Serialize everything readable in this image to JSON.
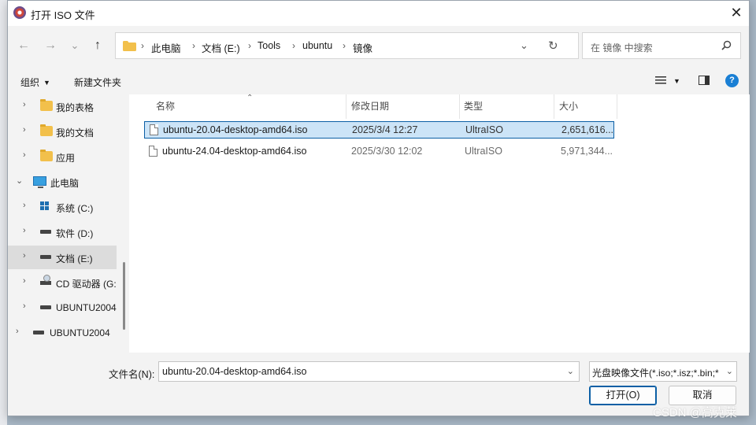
{
  "dialog": {
    "title": "打开 ISO 文件",
    "close_glyph": "✕"
  },
  "nav": {
    "back_glyph": "←",
    "forward_glyph": "→",
    "recent_glyph": "⌄",
    "up_glyph": "↑"
  },
  "address": {
    "crumbs": [
      "此电脑",
      "文档 (E:)",
      "Tools",
      "ubuntu",
      "镜像"
    ],
    "separator": "›",
    "dropdown_glyph": "⌄",
    "refresh_glyph": "↻"
  },
  "search": {
    "placeholder": "在 镜像 中搜索"
  },
  "toolbar": {
    "organize_label": "组织",
    "organize_caret": "▼",
    "new_folder_label": "新建文件夹",
    "view_caret": "▼",
    "help_glyph": "?"
  },
  "sidebar": {
    "items": [
      {
        "label": "我的表格",
        "icon": "folder-icon",
        "chevron": "›"
      },
      {
        "label": "我的文档",
        "icon": "folder-icon",
        "chevron": "›"
      },
      {
        "label": "应用",
        "icon": "folder-icon",
        "chevron": "›"
      },
      {
        "label": "此电脑",
        "icon": "pc-icon",
        "chevron": "⌄"
      },
      {
        "label": "系统 (C:)",
        "icon": "windows-drive-icon",
        "chevron": "›"
      },
      {
        "label": "软件 (D:)",
        "icon": "drive-icon",
        "chevron": "›"
      },
      {
        "label": "文档 (E:)",
        "icon": "drive-icon",
        "chevron": "›"
      },
      {
        "label": "CD 驱动器 (G:",
        "icon": "cd-drive-icon",
        "chevron": "›"
      },
      {
        "label": "UBUNTU2004",
        "icon": "drive-icon",
        "chevron": "›"
      },
      {
        "label": "UBUNTU2004",
        "icon": "drive-icon",
        "chevron": "›"
      }
    ]
  },
  "filelist": {
    "sort_glyph": "⌃",
    "columns": [
      "名称",
      "修改日期",
      "类型",
      "大小"
    ],
    "rows": [
      {
        "name": "ubuntu-20.04-desktop-amd64.iso",
        "modified": "2025/3/4 12:27",
        "type": "UltraISO",
        "size": "2,651,616..."
      },
      {
        "name": "ubuntu-24.04-desktop-amd64.iso",
        "modified": "2025/3/30 12:02",
        "type": "UltraISO",
        "size": "5,971,344..."
      }
    ]
  },
  "footer": {
    "filename_label": "文件名(N):",
    "filename_value": "ubuntu-20.04-desktop-amd64.iso",
    "dropdown_glyph": "⌄",
    "filetype_value": "光盘映像文件(*.iso;*.isz;*.bin;*",
    "open_label": "打开(O)",
    "cancel_label": "取消"
  },
  "watermark": "CSDN @高克莱",
  "colors": {
    "accent": "#0b5fa5",
    "selection": "#cce4f7",
    "folder": "#f2c04b",
    "help": "#1a7fd4"
  }
}
